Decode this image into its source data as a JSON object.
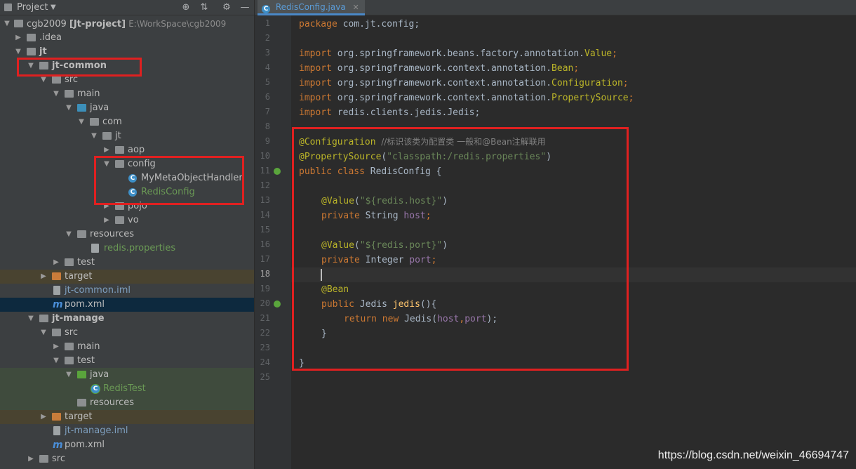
{
  "sidebar": {
    "title": "Project",
    "tree": [
      {
        "label": "cgb2009",
        "suffix": "[Jt-project]",
        "path": "E:\\WorkSpace\\cgb2009"
      },
      {
        "label": ".idea"
      },
      {
        "label": "jt"
      },
      {
        "label": "jt-common"
      },
      {
        "label": "src"
      },
      {
        "label": "main"
      },
      {
        "label": "java"
      },
      {
        "label": "com"
      },
      {
        "label": "jt"
      },
      {
        "label": "aop"
      },
      {
        "label": "config"
      },
      {
        "label": "MyMetaObjectHandler"
      },
      {
        "label": "RedisConfig"
      },
      {
        "label": "pojo"
      },
      {
        "label": "vo"
      },
      {
        "label": "resources"
      },
      {
        "label": "redis.properties"
      },
      {
        "label": "test"
      },
      {
        "label": "target"
      },
      {
        "label": "jt-common.iml"
      },
      {
        "label": "pom.xml"
      },
      {
        "label": "jt-manage"
      },
      {
        "label": "src"
      },
      {
        "label": "main"
      },
      {
        "label": "test"
      },
      {
        "label": "java"
      },
      {
        "label": "RedisTest"
      },
      {
        "label": "resources"
      },
      {
        "label": "target"
      },
      {
        "label": "jt-manage.iml"
      },
      {
        "label": "pom.xml"
      },
      {
        "label": "src"
      }
    ]
  },
  "editor": {
    "tab_label": "RedisConfig.java",
    "line_numbers": [
      "1",
      "2",
      "3",
      "4",
      "5",
      "6",
      "7",
      "8",
      "9",
      "10",
      "11",
      "12",
      "13",
      "14",
      "15",
      "16",
      "17",
      "18",
      "19",
      "20",
      "21",
      "22",
      "23",
      "24",
      "25"
    ],
    "code": {
      "l1_kw": "package",
      "l1_rest": " com.jt.config;",
      "l3_kw": "import",
      "l3_rest": " org.springframework.beans.factory.annotation.",
      "l3_cls": "Value",
      "l4_kw": "import",
      "l4_rest": " org.springframework.context.annotation.",
      "l4_cls": "Bean",
      "l5_kw": "import",
      "l5_rest": " org.springframework.context.annotation.",
      "l5_cls": "Configuration",
      "l6_kw": "import",
      "l6_rest": " org.springframework.context.annotation.",
      "l6_cls": "PropertySource",
      "l7_kw": "import",
      "l7_rest": " redis.clients.jedis.Jedis;",
      "l9_ann": "@Configuration",
      "l9_cm": "  //标识该类为配置类 一般和@Bean注解联用",
      "l10_ann": "@PropertySource",
      "l10_p1": "(",
      "l10_str": "\"classpath:/redis.properties\"",
      "l10_p2": ")",
      "l11_kw": "public class",
      "l11_rest": " RedisConfig {",
      "l13_ann": "@Value",
      "l13_p1": "(",
      "l13_str": "\"${redis.host}\"",
      "l13_p2": ")",
      "l14_kw": "private",
      "l14_type": " String ",
      "l14_fld": "host",
      "l14_semi": ";",
      "l16_ann": "@Value",
      "l16_p1": "(",
      "l16_str": "\"${redis.port}\"",
      "l16_p2": ")",
      "l17_kw": "private",
      "l17_type": " Integer ",
      "l17_fld": "port",
      "l17_semi": ";",
      "l19_ann": "@Bean",
      "l20_kw": "public",
      "l20_type": " Jedis ",
      "l20_fn": "jedis",
      "l20_rest": "(){",
      "l21_kw1": "return",
      "l21_kw2": " new",
      "l21_r1": " Jedis(",
      "l21_f1": "host",
      "l21_c": ",",
      "l21_f2": "port",
      "l21_r2": ");",
      "l22": "}",
      "l24": "}"
    }
  },
  "watermark": "https://blog.csdn.net/weixin_46694747",
  "colors": {
    "highlight_box": "#e02020",
    "keyword": "#cc7832",
    "annotation": "#bbb529",
    "string": "#6a8759",
    "field": "#9876aa"
  }
}
